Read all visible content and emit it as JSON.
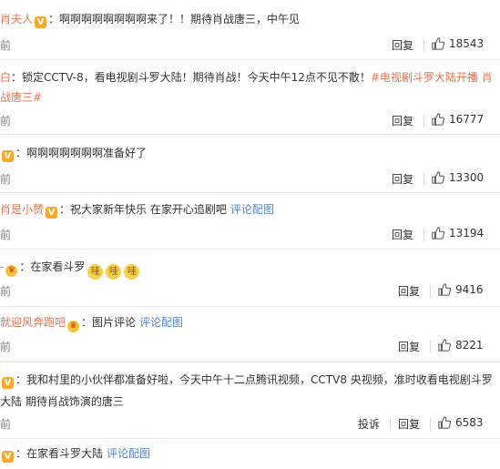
{
  "comments": [
    {
      "name": "肖夫人",
      "badge": "V",
      "sep": "：",
      "text": "啊啊啊啊啊啊啊啊来了！！期待肖战唐三，中午见",
      "time": "前",
      "reply": "回复",
      "likes": "18543"
    },
    {
      "name": "白",
      "sep": "：",
      "text_a": "锁定CCTV-8，看电视剧斗罗大陆！期待肖战！今天中午12点不见不散！",
      "topic": "#电视剧斗罗大陆开播 肖战唐三#",
      "time": "前",
      "reply": "回复",
      "likes": "16777"
    },
    {
      "badge": "V",
      "sep": "：",
      "text": "啊啊啊啊啊啊啊准备好了",
      "time": "前",
      "reply": "回复",
      "likes": "13300"
    },
    {
      "name": "肖是小赞",
      "badge": "V",
      "sep": "：",
      "text": "祝大家新年快乐 在家开心追剧吧",
      "link": "评论配图",
      "time": "前",
      "reply": "回复",
      "likes": "13194"
    },
    {
      "name": "-",
      "sep": "：",
      "text": "在家看斗罗",
      "emojis": [
        "哇",
        "哇",
        "哇"
      ],
      "time": "前",
      "reply": "回复",
      "likes": "9416"
    },
    {
      "name": "就迎风奔跑吧",
      "sep": "：",
      "text": "图片评论",
      "link": "评论配图",
      "time": "前",
      "reply": "回复",
      "likes": "8221"
    },
    {
      "badge": "V",
      "sep": "：",
      "text": "我和村里的小伙伴都准备好啦，今天中午十二点腾讯视频，CCTV8 央视频，准时收看电视剧斗罗大陆 期待肖战饰演的唐三",
      "time": "前",
      "report": "投诉",
      "reply": "回复",
      "likes": "6583"
    },
    {
      "badge": "V",
      "sep": "：",
      "text": "在家看斗罗大陆",
      "link": "评论配图"
    }
  ],
  "crown_glyph": "♛",
  "colors": {
    "username": "#eb7350",
    "link": "#5a84c9",
    "badge": "#f7a92b"
  }
}
